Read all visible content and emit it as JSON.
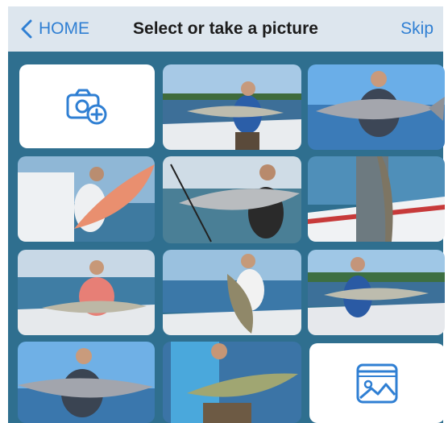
{
  "navbar": {
    "back_label": "HOME",
    "title": "Select or take a picture",
    "skip_label": "Skip"
  },
  "tiles": {
    "camera": {
      "icon": "camera-plus-icon"
    },
    "gallery": {
      "icon": "photo-gallery-icon"
    }
  },
  "colors": {
    "accent": "#2f7fd3",
    "navbar_bg": "#dde6ee",
    "grid_bg": "#2f6f8f"
  }
}
